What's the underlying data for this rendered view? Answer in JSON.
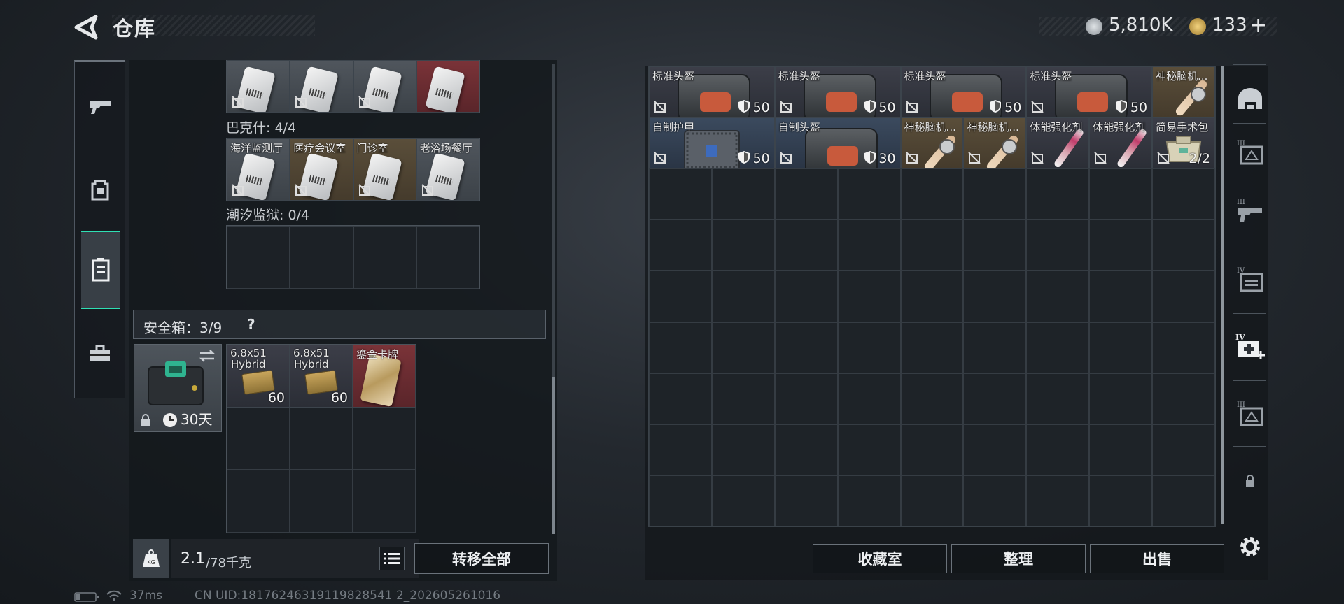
{
  "header": {
    "title": "仓库",
    "currency_silver": "5,810K",
    "currency_gold": "133",
    "currency_plus": "+"
  },
  "left_nav": [
    "gun-icon",
    "backpack-icon",
    "container-icon",
    "toolbox-icon"
  ],
  "keycards": {
    "bakshi_row": [
      {
        "color": "grey"
      },
      {
        "color": "grey"
      },
      {
        "color": "grey"
      },
      {
        "color": "red"
      }
    ],
    "bakshi_label": "巴克什: 4/4",
    "tide_row": [
      {
        "name": "海洋监测厅",
        "color": "grey"
      },
      {
        "name": "医疗会议室",
        "color": "gold"
      },
      {
        "name": "门诊室",
        "color": "gold"
      },
      {
        "name": "老浴场餐厅",
        "color": "grey"
      }
    ],
    "prison_label": "潮汐监狱: 0/4"
  },
  "safe_box": {
    "label": "安全箱：3/9",
    "help": "?",
    "duration": "30天",
    "items": [
      {
        "name_line1": "6.8x51",
        "name_line2": "Hybrid",
        "count": "60"
      },
      {
        "name_line1": "6.8x51",
        "name_line2": "Hybrid",
        "count": "60"
      },
      {
        "name_line1": "鎏金卡牌",
        "name_line2": "",
        "count": ""
      }
    ]
  },
  "bottom_left": {
    "weight_current": "2.1",
    "weight_max": "/78千克",
    "transfer_all": "转移全部"
  },
  "stash": {
    "row1": [
      {
        "name": "标准头盔",
        "value": "50",
        "color": "dark"
      },
      {
        "name": "标准头盔",
        "value": "50",
        "color": "dark"
      },
      {
        "name": "标准头盔",
        "value": "50",
        "color": "dark"
      },
      {
        "name": "标准头盔",
        "value": "50",
        "color": "dark"
      },
      {
        "name": "神秘脑机...",
        "value": "",
        "color": "gold"
      }
    ],
    "row2": [
      {
        "name": "自制护甲",
        "value": "50",
        "color": "blue"
      },
      {
        "name": "自制头盔",
        "value": "30",
        "color": "blue"
      },
      {
        "name": "神秘脑机...",
        "value": "",
        "color": "gold"
      },
      {
        "name": "神秘脑机...",
        "value": "",
        "color": "gold"
      },
      {
        "name": "体能强化剂",
        "value": "",
        "color": "dark"
      },
      {
        "name": "体能强化剂",
        "value": "",
        "color": "dark"
      },
      {
        "name": "简易手术包",
        "value": "2/2",
        "color": "dark"
      }
    ]
  },
  "bottom_right": {
    "collection": "收藏室",
    "sort": "整理",
    "sell": "出售"
  },
  "right_nav": [
    "helmet-slot-icon",
    "tier3-vest-icon",
    "tier3-gun-icon",
    "tier4-bag-icon",
    "tier4-medkit-icon",
    "tier3-box-icon",
    "lock-icon",
    "settings-icon"
  ],
  "status": {
    "ping": "37ms",
    "uid": "CN UID:18176246319119828541 2_202605261016"
  },
  "colors": {
    "accent": "#2fe0b4",
    "gold_item": "#5a4e3a",
    "red_item": "#7a3338",
    "blue_item": "#3b4a5e"
  }
}
